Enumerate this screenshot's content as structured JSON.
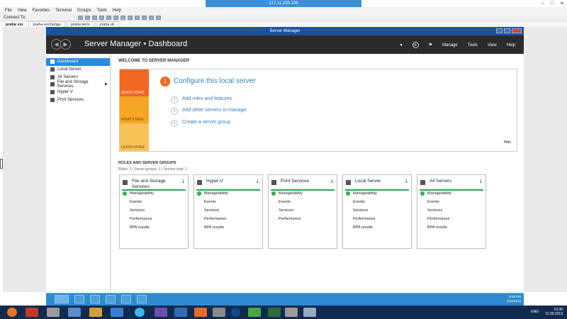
{
  "rdm": {
    "connection": "217.11.235.106",
    "menus": [
      "File",
      "View",
      "Favorites",
      "Terminal",
      "Groups",
      "Tools",
      "Help"
    ],
    "connect_label": "Connect To:",
    "tabs": [
      "praha vm",
      "praha exchange",
      "praha term",
      "praha dc"
    ]
  },
  "window": {
    "title": "Server Manager"
  },
  "header": {
    "breadcrumb": "Server Manager • Dashboard",
    "menu": [
      "Manage",
      "Tools",
      "View",
      "Help"
    ]
  },
  "sidebar": {
    "items": [
      {
        "label": "Dashboard",
        "icon": "dashboard-icon"
      },
      {
        "label": "Local Server",
        "icon": "server-icon"
      },
      {
        "label": "All Servers",
        "icon": "servers-icon"
      },
      {
        "label": "File and Storage Services",
        "icon": "storage-icon"
      },
      {
        "label": "Hyper-V",
        "icon": "hyperv-icon"
      },
      {
        "label": "Print Services",
        "icon": "printer-icon"
      }
    ]
  },
  "welcome": {
    "title": "WELCOME TO SERVER MANAGER",
    "tiles": [
      "QUICK START",
      "WHAT'S NEW",
      "LEARN MORE"
    ],
    "steps": [
      {
        "num": "1",
        "label": "Configure this local server"
      },
      {
        "num": "2",
        "label": "Add roles and features"
      },
      {
        "num": "3",
        "label": "Add other servers to manage"
      },
      {
        "num": "4",
        "label": "Create a server group"
      }
    ],
    "hide": "Hide"
  },
  "groups": {
    "title": "ROLES AND SERVER GROUPS",
    "subtitle": "Roles: 3   |   Server groups: 1   |   Servers total: 1",
    "cards": [
      {
        "title": "File and Storage Services",
        "count": "1",
        "rows": [
          "Manageability",
          "Events",
          "Services",
          "Performance",
          "BPA results"
        ]
      },
      {
        "title": "Hyper-V",
        "count": "1",
        "rows": [
          "Manageability",
          "Events",
          "Services",
          "Performance",
          "BPA results"
        ]
      },
      {
        "title": "Print Services",
        "count": "1",
        "rows": [
          "Manageability",
          "Events",
          "Services",
          "Performance"
        ]
      },
      {
        "title": "Local Server",
        "count": "1",
        "rows": [
          "Manageability",
          "Events",
          "Services",
          "Performance",
          "BPA results"
        ]
      },
      {
        "title": "All Servers",
        "count": "1",
        "rows": [
          "Manageability",
          "Events",
          "Services",
          "Performance",
          "BPA results"
        ]
      }
    ]
  },
  "inner_clock": {
    "time": "9:36 PM",
    "date": "6/11/2013"
  },
  "outer_clock": {
    "time": "23:36",
    "date": "11.06.2013",
    "lang": "ENG"
  }
}
